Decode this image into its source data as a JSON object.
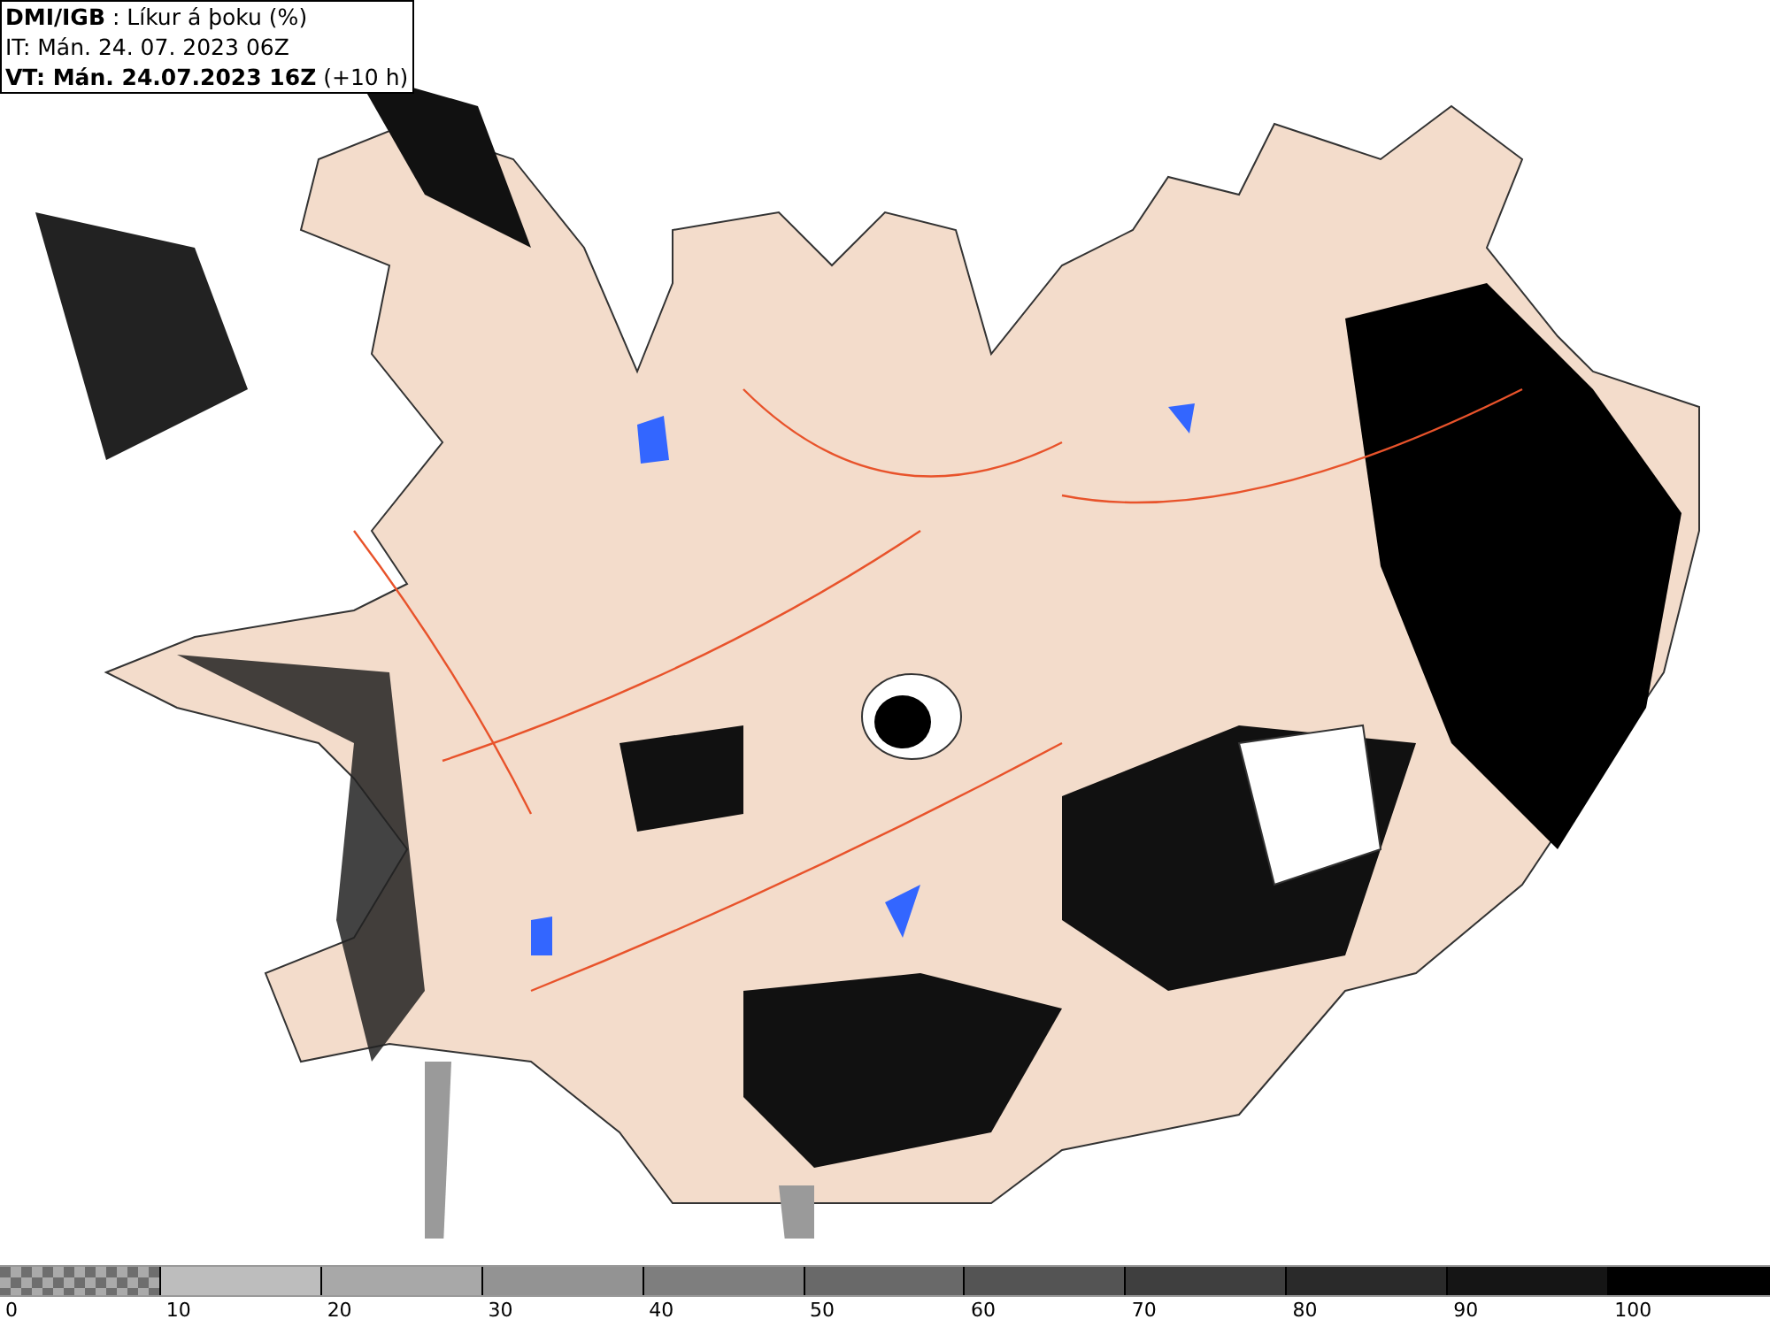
{
  "header": {
    "lines": [
      "**DMI/IGB** : Líkur á þoku (%)",
      "IT: Mán. 24. 07. 2023 06Z",
      "**VT: Mán. 24.07.2023 16Z** (+10 h)"
    ]
  },
  "legend": {
    "segments": [
      {
        "kind": "checker",
        "color": "#6e6e6e",
        "label": "0"
      },
      {
        "kind": "solid",
        "color": "#bdbdbd",
        "label": "10"
      },
      {
        "kind": "solid",
        "color": "#a8a8a8",
        "label": "20"
      },
      {
        "kind": "solid",
        "color": "#939393",
        "label": "30"
      },
      {
        "kind": "solid",
        "color": "#7e7e7e",
        "label": "40"
      },
      {
        "kind": "solid",
        "color": "#696969",
        "label": "50"
      },
      {
        "kind": "solid",
        "color": "#545454",
        "label": "60"
      },
      {
        "kind": "solid",
        "color": "#3f3f3f",
        "label": "70"
      },
      {
        "kind": "solid",
        "color": "#2a2a2a",
        "label": "80"
      },
      {
        "kind": "solid",
        "color": "#151515",
        "label": "90"
      },
      {
        "kind": "solid",
        "color": "#000000",
        "label": "100"
      }
    ]
  }
}
